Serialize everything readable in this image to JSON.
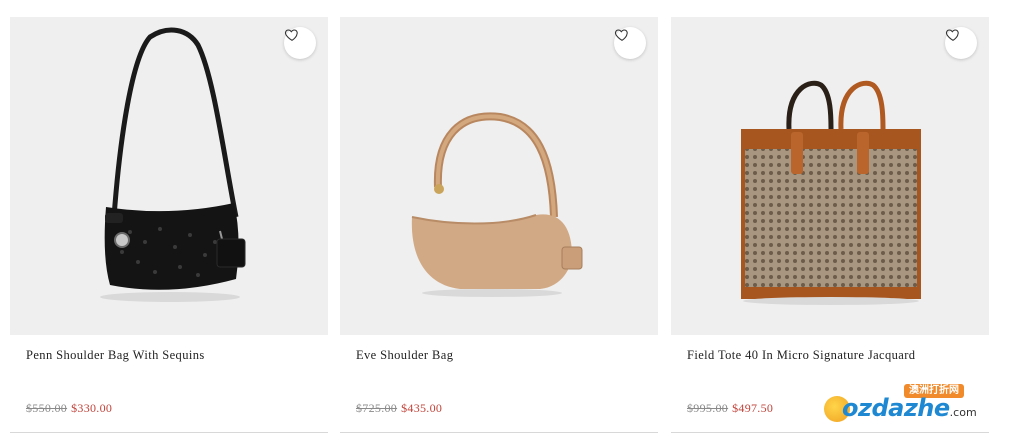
{
  "products": [
    {
      "name": "Penn Shoulder Bag With Sequins",
      "original_price": "$550.00",
      "sale_price": "$330.00",
      "wishlist_icon": "heart-icon",
      "image": "black-sequin-shoulder-bag"
    },
    {
      "name": "Eve Shoulder Bag",
      "original_price": "$725.00",
      "sale_price": "$435.00",
      "wishlist_icon": "heart-icon",
      "image": "tan-leather-hobo-bag"
    },
    {
      "name": "Field Tote 40 In Micro Signature Jacquard",
      "original_price": "$995.00",
      "sale_price": "$497.50",
      "wishlist_icon": "heart-icon",
      "image": "signature-jacquard-tote"
    }
  ],
  "watermark": {
    "banner": "澳洲打折网",
    "text": "ozdazhe",
    "suffix": ".com"
  },
  "colors": {
    "card_bg": "#efefef",
    "sale_price": "#c1443b",
    "old_price": "#8a8a8a"
  }
}
